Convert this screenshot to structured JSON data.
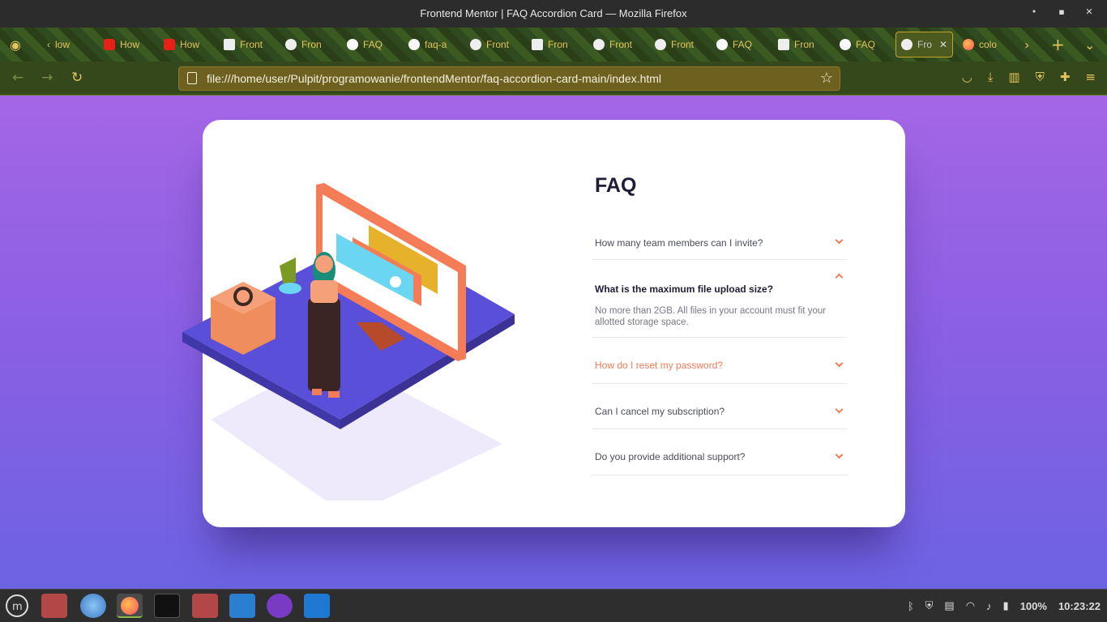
{
  "window": {
    "title": "Frontend Mentor | FAQ Accordion Card — Mozilla Firefox",
    "buttons": [
      "•",
      "▪",
      "✕"
    ]
  },
  "tabs": [
    {
      "label": "low",
      "icon": "back-arrow-icon"
    },
    {
      "label": "How",
      "icon": "youtube-icon"
    },
    {
      "label": "How",
      "icon": "youtube-icon"
    },
    {
      "label": "Front",
      "icon": "page-icon"
    },
    {
      "label": "Fron",
      "icon": "globe-icon"
    },
    {
      "label": "FAQ",
      "icon": "github-icon"
    },
    {
      "label": "faq-a",
      "icon": "github-icon"
    },
    {
      "label": "Front",
      "icon": "globe-icon"
    },
    {
      "label": "Fron",
      "icon": "page-icon"
    },
    {
      "label": "Front",
      "icon": "globe-icon"
    },
    {
      "label": "Front",
      "icon": "globe-icon"
    },
    {
      "label": "FAQ",
      "icon": "github-icon"
    },
    {
      "label": "Fron",
      "icon": "page-icon"
    },
    {
      "label": "FAQ",
      "icon": "github-icon"
    },
    {
      "label": "Fro",
      "icon": "globe-icon",
      "active": true
    },
    {
      "label": "colo",
      "icon": "firefox-icon"
    }
  ],
  "navbar": {
    "url": "file:///home/user/Pulpit/programowanie/frontendMentor/faq-accordion-card-main/index.html"
  },
  "faq": {
    "title": "FAQ",
    "items": [
      {
        "question": "How many team members can I invite?",
        "state": "closed"
      },
      {
        "question": "What is the maximum file upload size?",
        "state": "open",
        "answer": "No more than 2GB. All files in your account must fit your allotted storage space."
      },
      {
        "question": "How do I reset my password?",
        "state": "hover"
      },
      {
        "question": "Can I cancel my subscription?",
        "state": "closed"
      },
      {
        "question": "Do you provide additional support?",
        "state": "closed"
      }
    ]
  },
  "taskbar": {
    "battery": "100%",
    "clock": "10:23:22"
  },
  "colors": {
    "accent": "#f47c57",
    "heading": "#1d1e35",
    "gradient_top": "#a466e6",
    "gradient_bottom": "#6c63e3"
  }
}
